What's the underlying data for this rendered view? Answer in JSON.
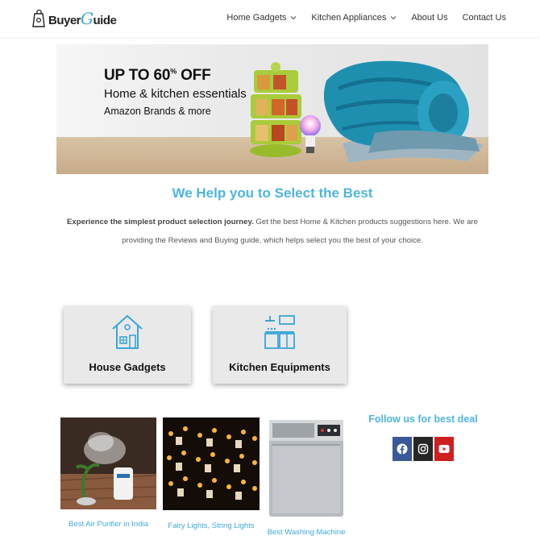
{
  "header": {
    "logo_left": "Buyer",
    "logo_g": "G",
    "logo_right": "uide",
    "nav": [
      {
        "label": "Home Gadgets",
        "dropdown": true
      },
      {
        "label": "Kitchen Appliances",
        "dropdown": true
      },
      {
        "label": "About Us",
        "dropdown": false
      },
      {
        "label": "Contact Us",
        "dropdown": false
      }
    ]
  },
  "banner": {
    "line1_main": "UP TO 60",
    "line1_sup": "%",
    "line1_end": " OFF",
    "line2": "Home & kitchen essentials",
    "line3": "Amazon Brands & more"
  },
  "headline": "We Help you to Select the Best",
  "intro": {
    "bold": "Experience the simplest product selection journey.",
    "rest": " Get the best Home & Kitchen products suggestions here. We are providing the Reviews and Buying guide, which helps select you the best of your choice."
  },
  "categories": [
    {
      "label": "House Gadgets",
      "icon": "house-icon"
    },
    {
      "label": "Kitchen Equipments",
      "icon": "kitchen-icon"
    }
  ],
  "products": [
    {
      "caption": "Best Air Purifier in India"
    },
    {
      "caption": "Fairy Lights, String Lights"
    },
    {
      "caption": "Best Washing Machine"
    }
  ],
  "follow": {
    "title": "Follow us for best deal",
    "icons": [
      "facebook-icon",
      "instagram-icon",
      "youtube-icon"
    ]
  },
  "colors": {
    "accent": "#4fb4e0",
    "facebook": "#3b5998",
    "instagram": "#262626",
    "youtube": "#cd201f"
  }
}
